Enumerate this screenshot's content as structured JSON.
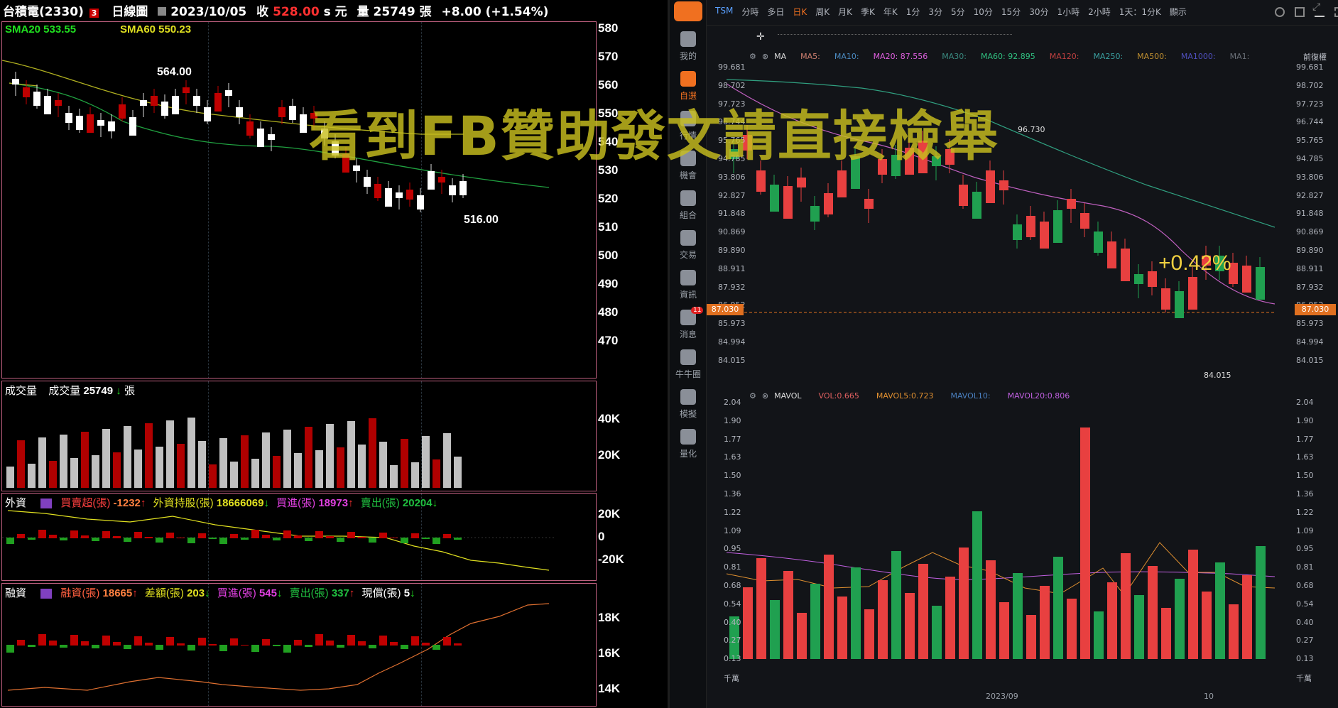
{
  "left": {
    "header": {
      "stock": "台積電(2330)",
      "badge": "3",
      "chart_type": "日線圖",
      "date": "2023/10/05",
      "close_label": "收",
      "close": "528.00",
      "unit": "s 元",
      "vol_label": "量",
      "vol": "25749",
      "vol_unit": "張",
      "change": "+8.00 (+1.54%)"
    },
    "sma": {
      "sma20": "SMA20 533.55",
      "sma60": "SMA60 550.23"
    },
    "price_axis": [
      "580",
      "570",
      "560",
      "550",
      "540",
      "530",
      "520",
      "510",
      "500",
      "490",
      "480",
      "470"
    ],
    "annotations": {
      "high": "564.00",
      "low": "516.00"
    },
    "volume": {
      "title": "成交量",
      "label": "成交量",
      "value": "25749",
      "unit": "張",
      "axis": [
        "40K",
        "20K"
      ]
    },
    "foreign": {
      "title": "外資",
      "net_label": "買賣超(張)",
      "net": "-1232",
      "hold_label": "外資持股(張)",
      "hold": "18666069",
      "buy_label": "買進(張)",
      "buy": "18973",
      "sell_label": "賣出(張)",
      "sell": "20204",
      "axis": [
        "20K",
        "0",
        "-20K"
      ]
    },
    "margin": {
      "title": "融資",
      "bal_label": "融資(張)",
      "bal": "18665",
      "diff_label": "差額(張)",
      "diff": "203",
      "buy_label": "買進(張)",
      "buy": "545",
      "sell_label": "賣出(張)",
      "sell": "337",
      "repay_label": "現償(張)",
      "repay": "5",
      "axis": [
        "18K",
        "16K",
        "14K"
      ]
    }
  },
  "watermark": "看到FB贊助發文請直接檢舉",
  "right": {
    "sidebar": [
      {
        "label": "我的",
        "icon": "user-icon"
      },
      {
        "label": "自選",
        "icon": "star-chart-icon",
        "active": true
      },
      {
        "label": "行情",
        "icon": "market-icon"
      },
      {
        "label": "機會",
        "icon": "opportunity-icon"
      },
      {
        "label": "組合",
        "icon": "pie-icon"
      },
      {
        "label": "交易",
        "icon": "trade-icon"
      },
      {
        "label": "資訊",
        "icon": "news-icon"
      },
      {
        "label": "消息",
        "icon": "message-icon",
        "badge": "11"
      },
      {
        "label": "牛牛圈",
        "icon": "community-icon"
      },
      {
        "label": "模擬",
        "icon": "gamepad-icon"
      },
      {
        "label": "量化",
        "icon": "code-icon"
      }
    ],
    "timeframes": [
      "TSM",
      "分時",
      "多日",
      "日K",
      "周K",
      "月K",
      "季K",
      "年K",
      "1分",
      "3分",
      "5分",
      "10分",
      "15分",
      "30分",
      "1小時",
      "2小時",
      "1天：1分K",
      "顯示"
    ],
    "active_tf": "日K",
    "ma_bar": {
      "name": "MA",
      "items": [
        {
          "t": "MA5:",
          "c": "#d08070"
        },
        {
          "t": "MA10:",
          "c": "#4a8ac0"
        },
        {
          "t": "MA20:",
          "v": "87.556",
          "c": "#e060e0"
        },
        {
          "t": "MA30:",
          "c": "#3a8a80"
        },
        {
          "t": "MA60:",
          "v": "92.895",
          "c": "#30c080"
        },
        {
          "t": "MA120:",
          "c": "#c04040"
        },
        {
          "t": "MA250:",
          "c": "#3aa0a0"
        },
        {
          "t": "MA500:",
          "c": "#c09030"
        },
        {
          "t": "MA1000:",
          "c": "#5050c0"
        },
        {
          "t": "MA1:",
          "c": "#6a7078"
        }
      ],
      "adjust": "前復權"
    },
    "price_axis": [
      "99.681",
      "98.702",
      "97.723",
      "96.744",
      "95.765",
      "94.785",
      "93.806",
      "92.827",
      "91.848",
      "90.869",
      "89.890",
      "88.911",
      "87.932",
      "86.952",
      "85.973",
      "84.994",
      "84.015"
    ],
    "current_price": "87.030",
    "annotations": {
      "high": "96.730",
      "low": "84.015",
      "change": "+0.42%"
    },
    "mavol": {
      "name": "MAVOL",
      "vol_label": "VOL:",
      "vol": "0.665",
      "mavol5_label": "MAVOL5:",
      "mavol5": "0.723",
      "mavol10_label": "MAVOL10:",
      "mavol20_label": "MAVOL20:",
      "mavol20": "0.806"
    },
    "vol_axis": [
      "2.04",
      "1.90",
      "1.77",
      "1.63",
      "1.50",
      "1.36",
      "1.22",
      "1.09",
      "0.95",
      "0.81",
      "0.68",
      "0.54",
      "0.40",
      "0.27",
      "0.13",
      "千萬"
    ],
    "x_labels": [
      "2023/09",
      "10"
    ]
  },
  "colors": {
    "up_left": "#c00000",
    "down_left": "#c0c0c0",
    "up_right": "#e84040",
    "down_right": "#20a050"
  }
}
